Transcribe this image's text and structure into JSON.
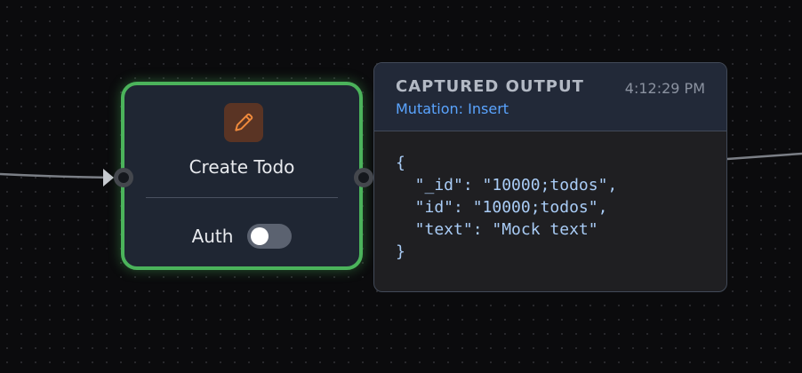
{
  "node": {
    "icon": "pencil-icon",
    "title": "Create Todo",
    "auth_label": "Auth",
    "auth_enabled": false
  },
  "output_panel": {
    "title": "CAPTURED OUTPUT",
    "timestamp": "4:12:29 PM",
    "subtitle": "Mutation: Insert",
    "code_lines": [
      "{",
      "  \"_id\": \"10000;todos\",",
      "  \"id\": \"10000;todos\",",
      "  \"text\": \"Mock text\"",
      "}"
    ]
  },
  "colors": {
    "background": "#0b0b0d",
    "node_border": "#4bb35b",
    "node_fill": "#1f2633",
    "icon_accent": "#f08a3c",
    "link_accent": "#5aa4ff",
    "code_text": "#a9ccf6"
  }
}
